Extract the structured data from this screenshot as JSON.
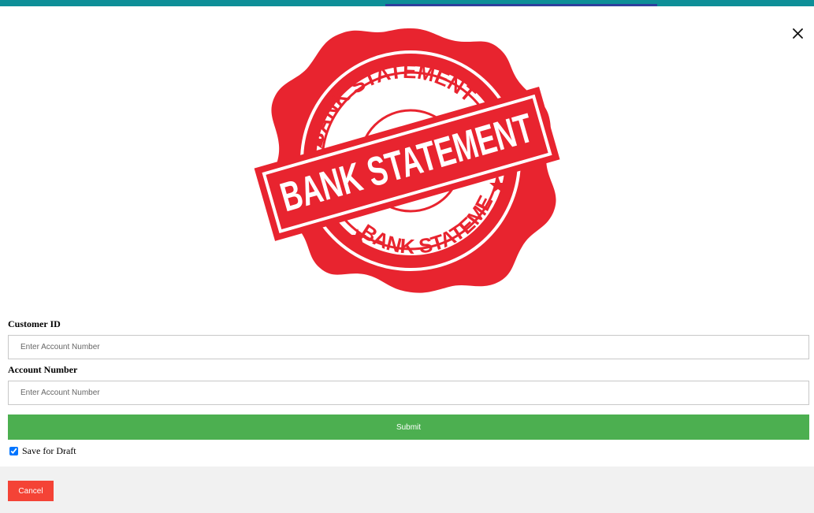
{
  "stamp": {
    "ring_top_text": "BANK STATEMENT",
    "banner_text": "BANK STATEMENT",
    "ring_bottom_text": "BANK STATEMENT",
    "color": "#e8242f"
  },
  "form": {
    "customer_id": {
      "label": "Customer ID",
      "placeholder": "Enter Account Number",
      "value": ""
    },
    "account_number": {
      "label": "Account Number",
      "placeholder": "Enter Account Number",
      "value": ""
    },
    "submit_label": "Submit",
    "save_draft": {
      "label": "Save for Draft",
      "checked": true
    }
  },
  "footer": {
    "cancel_label": "Cancel"
  },
  "icons": {
    "close": "close-icon"
  },
  "colors": {
    "top_bar": "#0e8f98",
    "top_accent": "#2f3f9e",
    "submit": "#4caf50",
    "cancel": "#f44336",
    "footer_bg": "#f1f1f1"
  }
}
